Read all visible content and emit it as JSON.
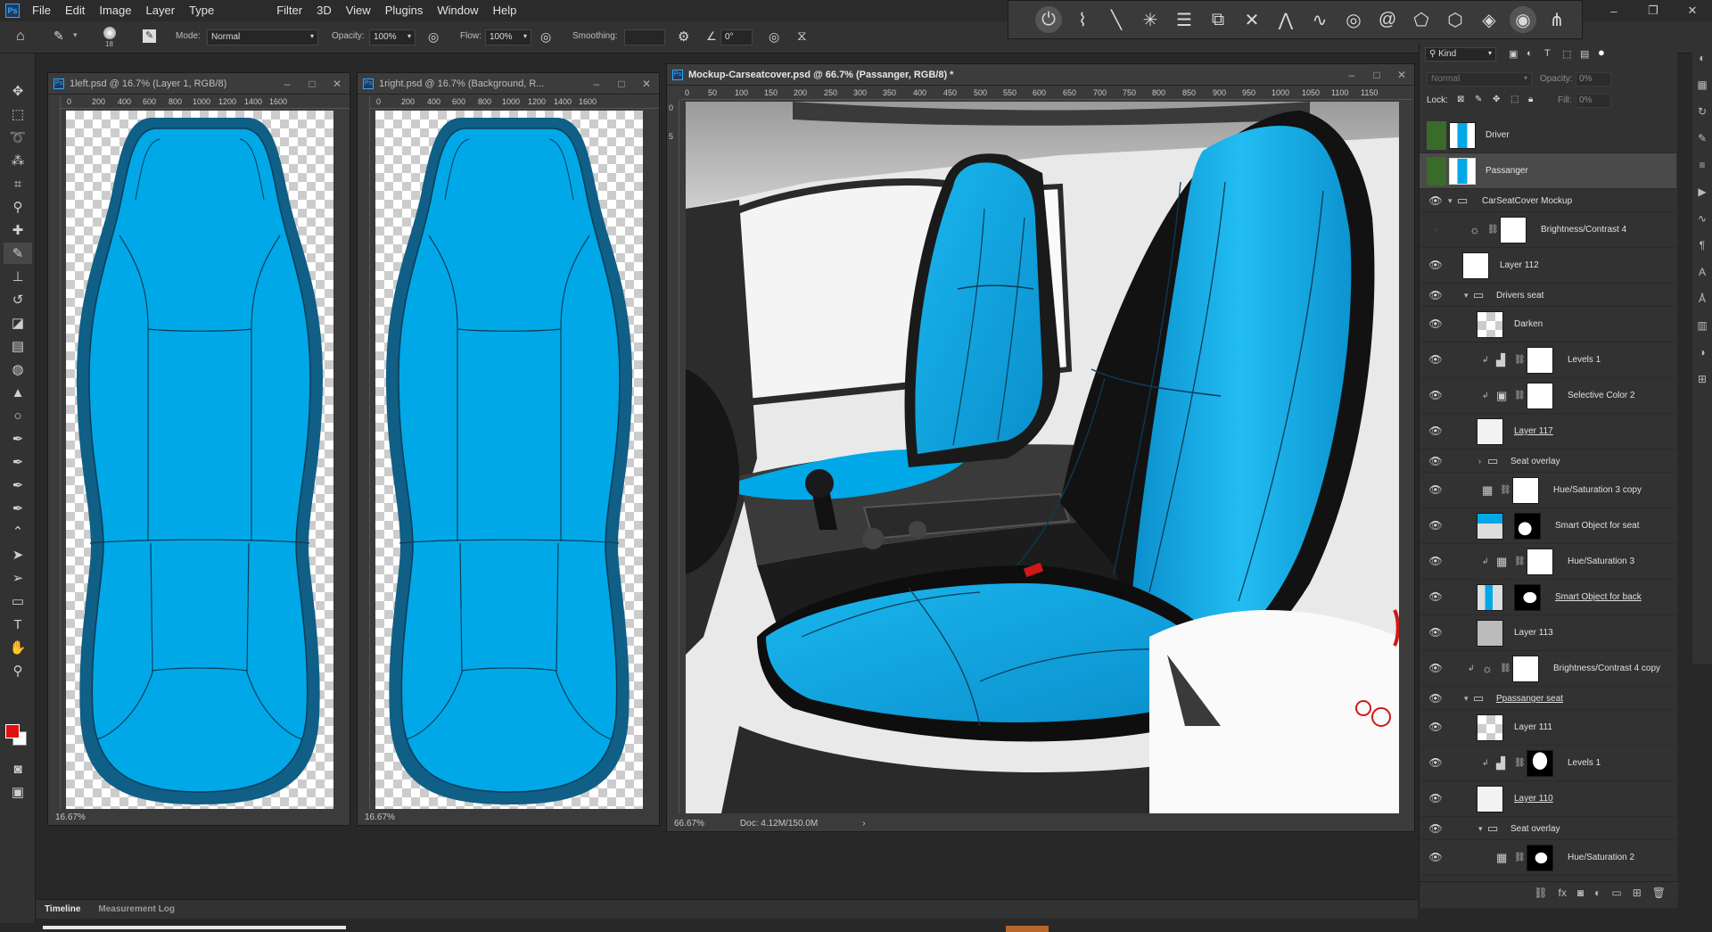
{
  "menu": {
    "logo": "Ps",
    "items": [
      "File",
      "Edit",
      "Image",
      "Layer",
      "Type",
      "Filter",
      "3D",
      "View",
      "Plugins",
      "Window",
      "Help"
    ]
  },
  "window_controls": {
    "minimize": "–",
    "restore": "❐",
    "close": "✕"
  },
  "options": {
    "brush_size": "18",
    "mode_label": "Mode:",
    "mode_value": "Normal",
    "opacity_label": "Opacity:",
    "opacity_value": "100%",
    "flow_label": "Flow:",
    "flow_value": "100%",
    "smoothing_label": "Smoothing:",
    "smoothing_value": "",
    "angle_value": "0°"
  },
  "icons": {
    "home": "home-icon",
    "brush": "brush-icon",
    "pressure": "pressure-icon",
    "gear": "gear-icon",
    "angle": "angle-icon",
    "symmetry": "symmetry-icon"
  },
  "documents": [
    {
      "title": "1left.psd @ 16.7% (Layer 1, RGB/8)",
      "zoom": "16.67%",
      "ruler": [
        "200",
        "400",
        "600",
        "800",
        "1000",
        "1200",
        "1400",
        "1600"
      ]
    },
    {
      "title": "1right.psd @ 16.7% (Background, R...",
      "zoom": "16.67%",
      "ruler": [
        "200",
        "400",
        "600",
        "800",
        "1000",
        "1200",
        "1400",
        "1600"
      ]
    },
    {
      "title": "Mockup-Carseatcover.psd @ 66.7% (Passanger, RGB/8) *",
      "zoom": "66.67%",
      "doc_info": "Doc: 4.12M/150.0M",
      "ruler": [
        "0",
        "50",
        "100",
        "150",
        "200",
        "250",
        "300",
        "350",
        "400",
        "450",
        "500",
        "550",
        "600",
        "650",
        "700",
        "750",
        "800",
        "850",
        "900",
        "950",
        "1000",
        "1050",
        "1100",
        "1150"
      ],
      "vruler": [
        "0",
        "5",
        "10",
        "15",
        "20",
        "25",
        "30",
        "35",
        "40",
        "45",
        "50",
        "55",
        "60",
        "65"
      ]
    }
  ],
  "layers_panel": {
    "filter_kind": "Kind",
    "blend_mode": "Normal",
    "opacity_label": "Opacity:",
    "opacity_value": "0%",
    "lock_label": "Lock:",
    "fill_label": "Fill:",
    "fill_value": "0%",
    "layers": [
      {
        "name": "Driver",
        "visible": false,
        "kind": "smart"
      },
      {
        "name": "Passanger",
        "visible": false,
        "kind": "smart",
        "selected": true
      },
      {
        "name": "CarSeatCover Mockup",
        "visible": true,
        "kind": "group",
        "expanded": true
      },
      {
        "name": "Brightness/Contrast 4",
        "visible": false,
        "kind": "adjustment"
      },
      {
        "name": "Layer 112",
        "visible": true,
        "kind": "pixel"
      },
      {
        "name": "Drivers seat",
        "visible": true,
        "kind": "group",
        "expanded": true
      },
      {
        "name": "Darken",
        "visible": true,
        "kind": "pixel"
      },
      {
        "name": "Levels 1",
        "visible": true,
        "kind": "adjustment"
      },
      {
        "name": "Selective Color 2",
        "visible": true,
        "kind": "adjustment"
      },
      {
        "name": "Layer 117",
        "visible": true,
        "kind": "pixel"
      },
      {
        "name": "Seat overlay",
        "visible": true,
        "kind": "group",
        "expanded": false
      },
      {
        "name": "Hue/Saturation 3 copy",
        "visible": true,
        "kind": "adjustment"
      },
      {
        "name": "Smart Object for seat",
        "visible": true,
        "kind": "smart"
      },
      {
        "name": "Hue/Saturation 3",
        "visible": true,
        "kind": "adjustment"
      },
      {
        "name": "Smart Object for back",
        "visible": true,
        "kind": "smart"
      },
      {
        "name": "Layer 113",
        "visible": true,
        "kind": "pixel"
      },
      {
        "name": "Brightness/Contrast 4 copy",
        "visible": true,
        "kind": "adjustment"
      },
      {
        "name": "Ppassanger seat",
        "visible": true,
        "kind": "group",
        "expanded": true
      },
      {
        "name": "Layer 111",
        "visible": true,
        "kind": "pixel"
      },
      {
        "name": "Levels 1",
        "visible": true,
        "kind": "adjustment"
      },
      {
        "name": "Layer 110",
        "visible": true,
        "kind": "pixel"
      },
      {
        "name": "Seat overlay",
        "visible": true,
        "kind": "group",
        "expanded": true
      },
      {
        "name": "Hue/Saturation 2",
        "visible": true,
        "kind": "adjustment"
      }
    ]
  },
  "timeline": {
    "tabs": [
      "Timeline",
      "Measurement Log"
    ]
  },
  "colors": {
    "seat_blue": "#00a8e8",
    "foreground": "#e01010",
    "background": "#ffffff"
  }
}
